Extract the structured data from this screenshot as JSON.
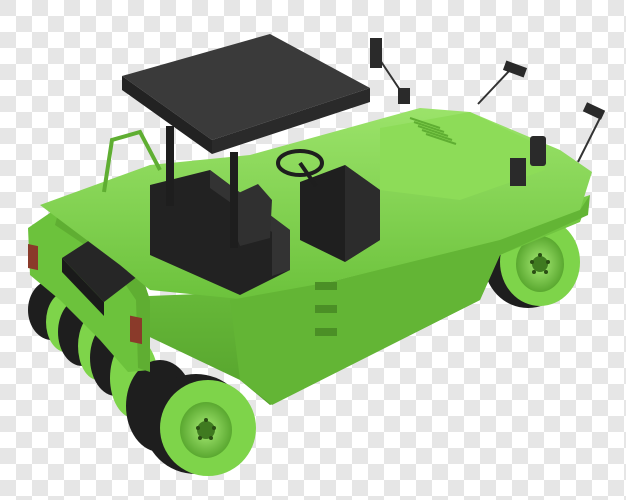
{
  "scene": {
    "subject": "pneumatic-tire-road-roller",
    "background": "transparency-checkerboard",
    "colors": {
      "checker_light": "#ffffff",
      "checker_dark": "#e6e6e6",
      "body_green": "#7ed44a",
      "body_green_light": "#9be36a",
      "body_green_dark": "#5fae32",
      "body_green_deep": "#4b8f26",
      "canopy": "#2a2a2a",
      "canopy_top": "#3a3a3a",
      "cab_black": "#222222",
      "tire_black": "#1e1e1e",
      "lamp_red": "#8a3a2a"
    }
  }
}
